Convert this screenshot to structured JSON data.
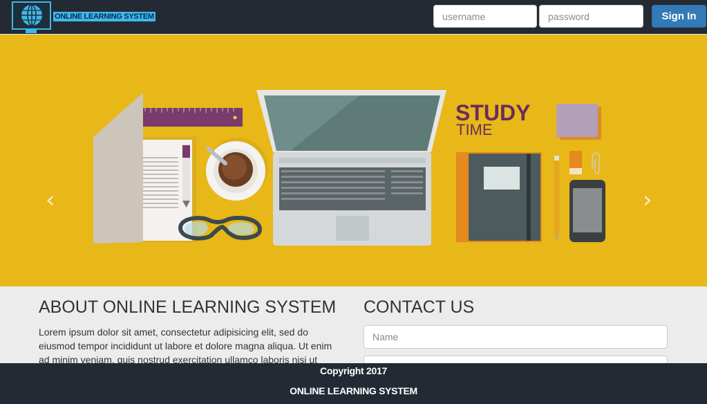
{
  "header": {
    "brand": "ONLINE LEARNING SYSTEM",
    "logo_icon": "globe-monitor-icon",
    "username_placeholder": "username",
    "password_placeholder": "password",
    "signin_label": "Sign In"
  },
  "carousel": {
    "slide_title": "STUDY",
    "slide_subtitle": "TIME",
    "prev_icon": "chevron-left-icon",
    "next_icon": "chevron-right-icon"
  },
  "about": {
    "title": "ABOUT ONLINE LEARNING SYSTEM",
    "text": "Lorem ipsum dolor sit amet, consectetur adipisicing elit, sed do eiusmod tempor incididunt ut labore et dolore magna aliqua. Ut enim ad minim veniam, quis nostrud exercitation ullamco laboris nisi ut"
  },
  "contact": {
    "title": "CONTACT US",
    "name_placeholder": "Name"
  },
  "footer": {
    "copyright": "Copyright 2017",
    "name": "ONLINE LEARNING SYSTEM"
  },
  "colors": {
    "navbar": "#232a33",
    "accent": "#3fb7e6",
    "hero_bg": "#ebba1a",
    "signin": "#337ab7"
  }
}
